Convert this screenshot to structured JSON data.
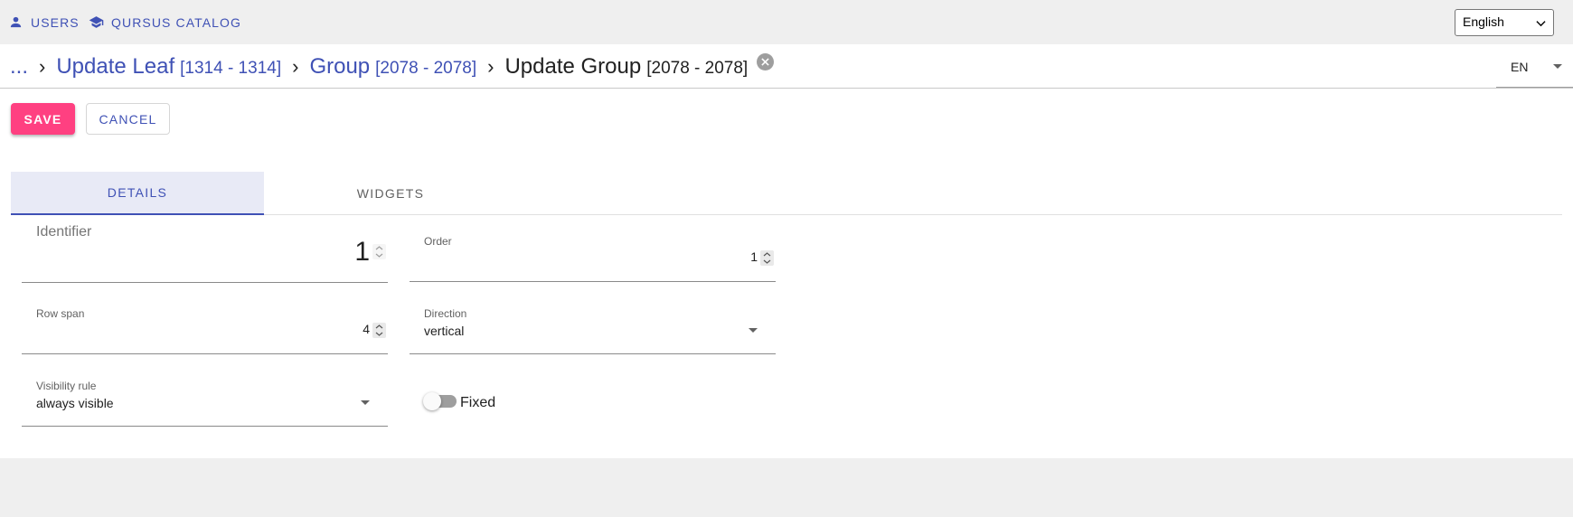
{
  "topnav": {
    "users_label": "Users",
    "users_icon": "person-icon",
    "catalog_label": "Qursus catalog",
    "catalog_icon": "school-icon",
    "language_selected": "English"
  },
  "breadcrumb": {
    "ellipsis": "...",
    "separator": "›",
    "items": [
      {
        "label": "Update Leaf",
        "range": "[1314 - 1314]"
      },
      {
        "label": "Group",
        "range": "[2078 - 2078]"
      }
    ],
    "current_label": "Update Group",
    "current_range": "[2078 - 2078]",
    "locale": "EN"
  },
  "actions": {
    "save_label": "Save",
    "cancel_label": "Cancel"
  },
  "tabs": [
    {
      "label": "Details",
      "active": true
    },
    {
      "label": "Widgets",
      "active": false
    }
  ],
  "form": {
    "identifier": {
      "label": "Identifier",
      "value": "1"
    },
    "order": {
      "label": "Order",
      "value": "1"
    },
    "row_span": {
      "label": "Row span",
      "value": "4"
    },
    "direction": {
      "label": "Direction",
      "value": "vertical"
    },
    "visibility_rule": {
      "label": "Visibility rule",
      "value": "always visible"
    },
    "fixed": {
      "label": "Fixed",
      "checked": false
    }
  },
  "colors": {
    "primary": "#3f51b5",
    "accent": "#ff4081",
    "active_tab_bg": "#e8eaf6"
  }
}
